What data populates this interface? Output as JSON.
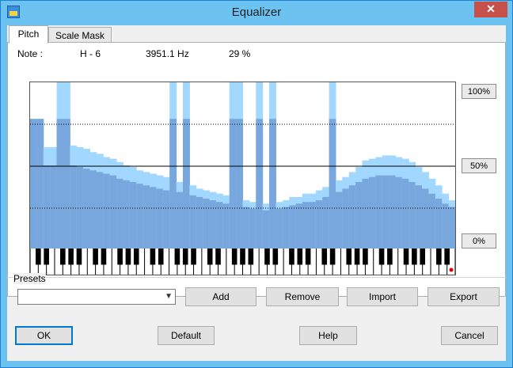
{
  "window": {
    "title": "Equalizer",
    "close_label": "✕"
  },
  "tabs": [
    {
      "label": "Pitch"
    },
    {
      "label": "Scale Mask"
    }
  ],
  "readout": {
    "label": "Note :",
    "note": "H - 6",
    "frequency": "3951.1 Hz",
    "percent": "29 %"
  },
  "scale_buttons": {
    "top": "100%",
    "mid": "50%",
    "bottom": "0%"
  },
  "eq_levels": {
    "light": [
      0.78,
      0.78,
      0.61,
      0.61,
      1.0,
      1.0,
      0.62,
      0.61,
      0.6,
      0.58,
      0.57,
      0.55,
      0.54,
      0.52,
      0.5,
      0.49,
      0.47,
      0.46,
      0.45,
      0.44,
      0.43,
      1.0,
      0.4,
      1.0,
      0.38,
      0.36,
      0.35,
      0.34,
      0.33,
      0.32,
      1.0,
      1.0,
      0.29,
      0.28,
      1.0,
      0.27,
      1.0,
      0.28,
      0.29,
      0.31,
      0.31,
      0.33,
      0.33,
      0.35,
      0.37,
      1.0,
      0.41,
      0.43,
      0.46,
      0.49,
      0.53,
      0.54,
      0.55,
      0.56,
      0.56,
      0.55,
      0.54,
      0.52,
      0.49,
      0.46,
      0.42,
      0.38,
      0.33,
      0.29
    ],
    "dark": [
      0.78,
      0.78,
      0.5,
      0.5,
      0.78,
      0.78,
      0.5,
      0.49,
      0.48,
      0.47,
      0.46,
      0.45,
      0.44,
      0.42,
      0.41,
      0.4,
      0.39,
      0.38,
      0.37,
      0.36,
      0.35,
      0.78,
      0.34,
      0.78,
      0.32,
      0.31,
      0.3,
      0.29,
      0.28,
      0.27,
      0.78,
      0.78,
      0.25,
      0.24,
      0.78,
      0.23,
      0.78,
      0.24,
      0.25,
      0.26,
      0.27,
      0.28,
      0.28,
      0.29,
      0.31,
      0.78,
      0.34,
      0.36,
      0.38,
      0.4,
      0.42,
      0.43,
      0.44,
      0.44,
      0.44,
      0.43,
      0.42,
      0.4,
      0.38,
      0.36,
      0.33,
      0.3,
      0.27,
      0.25
    ]
  },
  "presets": {
    "label": "Presets",
    "selected": "",
    "add_label": "Add",
    "remove_label": "Remove",
    "import_label": "Import",
    "export_label": "Export"
  },
  "footer": {
    "ok_label": "OK",
    "default_label": "Default",
    "help_label": "Help",
    "cancel_label": "Cancel"
  },
  "colors": {
    "bar_light": "#a2d8ff",
    "bar_dark": "#77a7dd",
    "marker": "#e00000"
  }
}
